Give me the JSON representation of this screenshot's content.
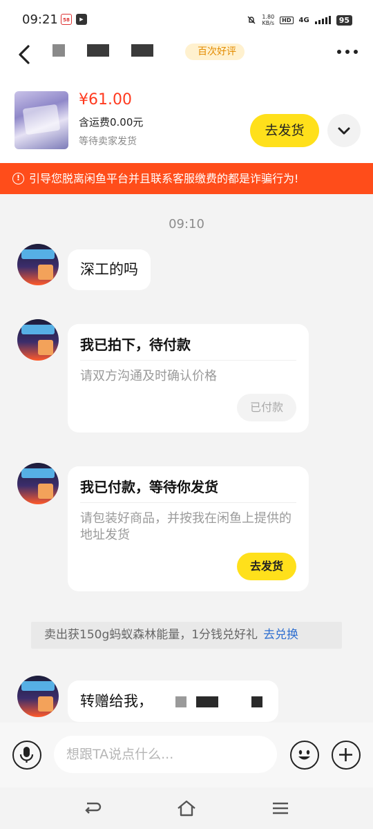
{
  "status_bar": {
    "time": "09:21",
    "app_icon_1": "58",
    "app_icon_2": "▶",
    "net_speed_value": "1.80",
    "net_speed_unit": "KB/s",
    "hd_badge": "HD",
    "network_type": "4G",
    "battery": "95",
    "icons": [
      "mute-icon",
      "signal-icon",
      "battery-icon"
    ]
  },
  "header": {
    "back_icon": "chevron-left-icon",
    "badge": "百次好评",
    "more_icon": "more-dots-icon"
  },
  "product": {
    "price": "¥61.00",
    "shipping_fee": "含运费0.00元",
    "status": "等待卖家发货",
    "ship_button": "去发货",
    "expand_icon": "chevron-down-icon"
  },
  "warning": {
    "icon": "exclamation-circle-icon",
    "text": "引导您脱离闲鱼平台并且联系客服缴费的都是诈骗行为!"
  },
  "chat": {
    "timestamp": "09:10",
    "msg1": "深工的吗",
    "card1": {
      "title": "我已拍下，待付款",
      "desc": "请双方沟通及时确认价格",
      "button": "已付款"
    },
    "card2": {
      "title": "我已付款，等待你发货",
      "desc": "请包装好商品，并按我在闲鱼上提供的地址发货",
      "button": "去发货"
    },
    "promo": {
      "text": "卖出获150g蚂蚁森林能量，1分钱兑好礼",
      "link": "去兑换"
    },
    "msg2": "转赠给我，"
  },
  "input_bar": {
    "placeholder": "想跟TA说点什么...",
    "voice_icon": "microphone-icon",
    "emoji_icon": "emoji-icon",
    "plus_icon": "plus-icon"
  },
  "nav_bar": {
    "icons": [
      "back-nav-icon",
      "home-icon",
      "menu-icon"
    ]
  },
  "colors": {
    "accent_yellow": "#ffe01b",
    "warning_red": "#ff4d1a",
    "price_red": "#ff3a1f",
    "link_blue": "#2f6fd0"
  }
}
